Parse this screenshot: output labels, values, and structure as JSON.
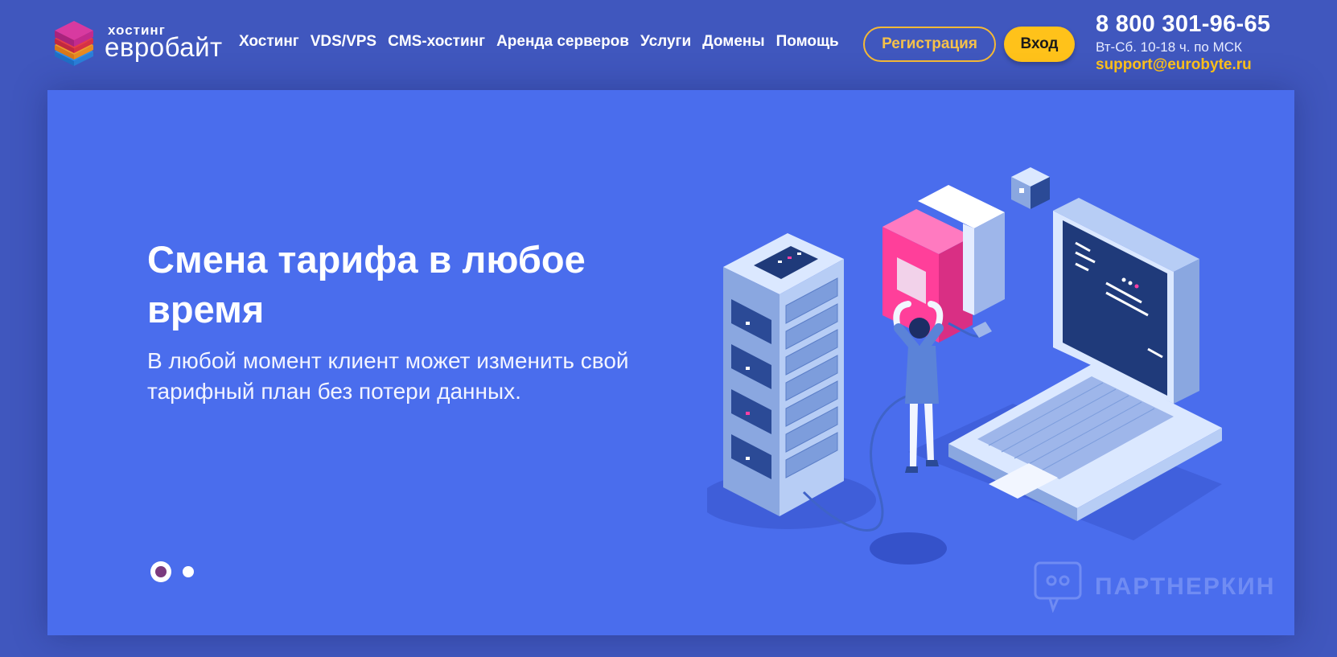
{
  "logo": {
    "small": "хостинг",
    "big": "евробайт"
  },
  "nav": [
    {
      "label": "Хостинг"
    },
    {
      "label": "VDS/VPS"
    },
    {
      "label": "CMS-хостинг"
    },
    {
      "label": "Аренда серверов"
    },
    {
      "label": "Услуги"
    },
    {
      "label": "Домены"
    },
    {
      "label": "Помощь"
    }
  ],
  "buttons": {
    "register": "Регистрация",
    "login": "Вход"
  },
  "contacts": {
    "phone": "8 800 301-96-65",
    "hours": "Вт-Сб. 10-18 ч. по МСК",
    "email": "support@eurobyte.ru"
  },
  "hero": {
    "title": "Смена тарифа в любое время",
    "subtitle": "В любой момент клиент может изменить свой тарифный план без потери данных."
  },
  "slider": {
    "active_index": 0,
    "count": 2
  },
  "watermark": "ПАРТНЕРКИН",
  "colors": {
    "page_bg": "#4057be",
    "hero_bg": "#4a6ded",
    "accent": "#ffc21a"
  }
}
